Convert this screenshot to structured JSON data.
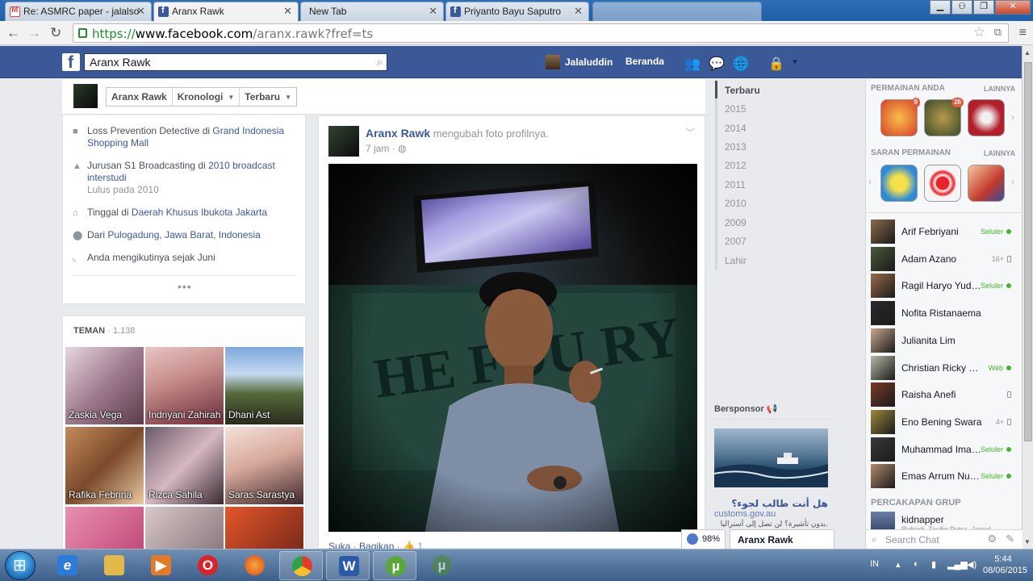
{
  "browser": {
    "tabs": [
      {
        "title": "Re: ASMRC paper - jalalso",
        "favicon": "gmail-icon"
      },
      {
        "title": "Aranx Rawk",
        "favicon": "facebook-icon",
        "active": true
      },
      {
        "title": "New Tab",
        "favicon": ""
      },
      {
        "title": "Priyanto Bayu Saputro",
        "favicon": "facebook-icon"
      }
    ],
    "url": {
      "protocol": "https://",
      "host": "www.facebook.com",
      "path": "/aranx.rawk?fref=ts"
    }
  },
  "fb_header": {
    "search_value": "Aranx Rawk",
    "user_name": "Jalaluddin",
    "home_label": "Beranda"
  },
  "profile_nav": {
    "crumbs": [
      "Aranx Rawk",
      "Kronologi",
      "Terbaru"
    ]
  },
  "intro": {
    "work": {
      "text": "Loss Prevention Detective di ",
      "link": "Grand Indonesia Shopping Mall"
    },
    "education": {
      "text": "Jurusan S1 Broadcasting di ",
      "link": "2010 broadcast interstudi",
      "sub": "Lulus pada 2010"
    },
    "lives": {
      "text": "Tinggal di ",
      "link": "Daerah Khusus Ibukota Jakarta"
    },
    "from": {
      "text": "Dari ",
      "link": "Pulogadung, Jawa Barat, Indonesia"
    },
    "follow": {
      "text": "Anda mengikutinya sejak Juni"
    },
    "more": "•••"
  },
  "friends": {
    "title": "TEMAN",
    "count": "· 1.138",
    "items": [
      {
        "name": "Zaskia Vega"
      },
      {
        "name": "Indriyani Zahirah"
      },
      {
        "name": "Dhani Ast"
      },
      {
        "name": "Rafika Febrina"
      },
      {
        "name": "Rizca Sahila"
      },
      {
        "name": "Saras Sarastya"
      },
      {
        "name": ""
      },
      {
        "name": ""
      },
      {
        "name": ""
      }
    ]
  },
  "post": {
    "author": "Aranx Rawk",
    "action": " mengubah foto profilnya.",
    "time": "7 jam",
    "like": "Suka",
    "share": "Bagikan",
    "like_count": "1"
  },
  "timeline": {
    "items": [
      "Terbaru",
      "2015",
      "2014",
      "2013",
      "2012",
      "2011",
      "2010",
      "2009",
      "2007",
      "Lahir"
    ]
  },
  "sponsored": {
    "header": "Bersponsor",
    "title": "هل أنت طالب لجوء؟",
    "domain": "customs.gov.au",
    "desc": "بدون تأشيرة؟ لن تصل إلى أستراليا."
  },
  "sidebar": {
    "games_header": "PERMAINAN ANDA",
    "games_more": "LAINNYA",
    "games": [
      {
        "name": "candy-crush-icon",
        "badge": "9",
        "color": "#d8402a"
      },
      {
        "name": "strategy-game-icon",
        "badge": "26",
        "color": "#6b5a2a"
      },
      {
        "name": "poker-game-icon",
        "badge": "",
        "color": "#b21f2a"
      }
    ],
    "suggest_header": "SARAN PERMAINAN",
    "suggest_more": "LAINNYA",
    "suggest": [
      {
        "name": "monster-game-icon",
        "color": "#2f8bd8"
      },
      {
        "name": "target-game-icon",
        "color": "#e8e8e8"
      },
      {
        "name": "poker-pro-icon",
        "color": "#c23a2e"
      }
    ],
    "chat": [
      {
        "name": "Arif Febriyani",
        "status": "Seluler",
        "type": "mobile-green"
      },
      {
        "name": "Adam Azano",
        "status": "16+",
        "type": "phone"
      },
      {
        "name": "Ragil Haryo Yudhanto",
        "status": "Seluler",
        "type": "mobile-green"
      },
      {
        "name": "Nofita Ristanaema",
        "status": "",
        "type": "none"
      },
      {
        "name": "Julianita Lim",
        "status": "",
        "type": "none"
      },
      {
        "name": "Christian Ricky Lamandasa",
        "status": "Web",
        "type": "web"
      },
      {
        "name": "Raisha Anefi",
        "status": "",
        "type": "phone"
      },
      {
        "name": "Eno Bening Swara",
        "status": "4+",
        "type": "phone"
      },
      {
        "name": "Muhammad Imaduddin",
        "status": "Seluler",
        "type": "mobile-green"
      },
      {
        "name": "Emas Arrum Nurani",
        "status": "Seluler",
        "type": "mobile-green"
      }
    ],
    "group_header": "PERCAKAPAN GRUP",
    "group_name": "kidnapper",
    "group_sub": "Rahadi, Taufiq Putra, Jamal",
    "chat_search_placeholder": "Search Chat"
  },
  "chat_tab": {
    "name": "Aranx Rawk",
    "zoom": "98%"
  },
  "taskbar": {
    "lang": "IN",
    "time": "5:44",
    "date": "08/06/2015"
  }
}
